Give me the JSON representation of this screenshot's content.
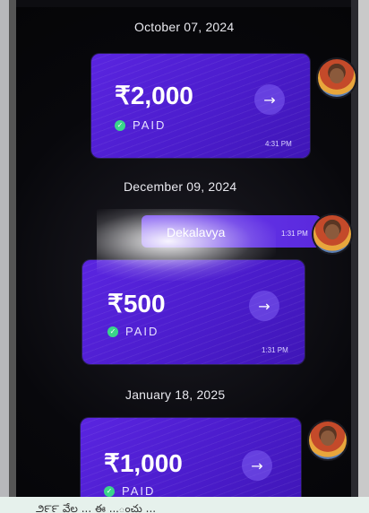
{
  "transactions": [
    {
      "date": "October 07, 2024",
      "amount": "₹2,000",
      "status": "PAID",
      "time": "4:31 PM"
    },
    {
      "date": "December 09, 2024",
      "amount": "₹500",
      "status": "PAID",
      "time": "1:31 PM"
    },
    {
      "date": "January 18, 2025",
      "amount": "₹1,000",
      "status": "PAID",
      "time": ""
    }
  ],
  "message": {
    "name": "Dekalavya",
    "time": "1:31 PM",
    "marker": "o"
  },
  "icons": {
    "status": "check-circle-icon",
    "action": "arrow-right-icon"
  },
  "colors": {
    "card": "#4b1ccc",
    "paid_check": "#3ad58a",
    "background": "#08080c"
  },
  "caption": "౨౯౯ వేల ... ఈ ...ంచు ..."
}
